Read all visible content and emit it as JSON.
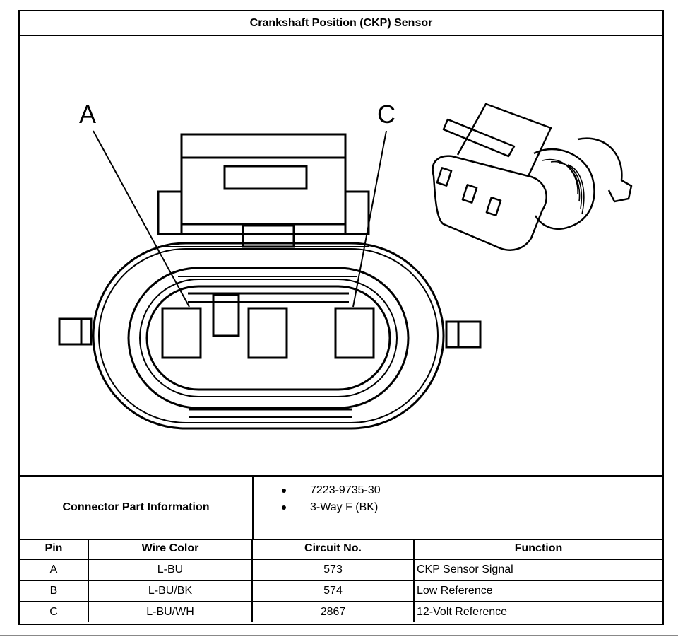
{
  "title": "Crankshaft Position (CKP) Sensor",
  "figure": {
    "callouts": [
      {
        "label": "A",
        "pin": "A"
      },
      {
        "label": "C",
        "pin": "C"
      }
    ],
    "views": [
      "connector-face-view",
      "connector-isometric-view"
    ]
  },
  "connector_info": {
    "label": "Connector Part Information",
    "items": [
      "7223-9735-30",
      "3-Way F (BK)"
    ]
  },
  "pin_table": {
    "headers": [
      "Pin",
      "Wire Color",
      "Circuit No.",
      "Function"
    ],
    "rows": [
      {
        "pin": "A",
        "wire_color": "L-BU",
        "circuit": "573",
        "function": "CKP Sensor Signal"
      },
      {
        "pin": "B",
        "wire_color": "L-BU/BK",
        "circuit": "574",
        "function": "Low Reference"
      },
      {
        "pin": "C",
        "wire_color": "L-BU/WH",
        "circuit": "2867",
        "function": "12-Volt Reference"
      }
    ]
  }
}
